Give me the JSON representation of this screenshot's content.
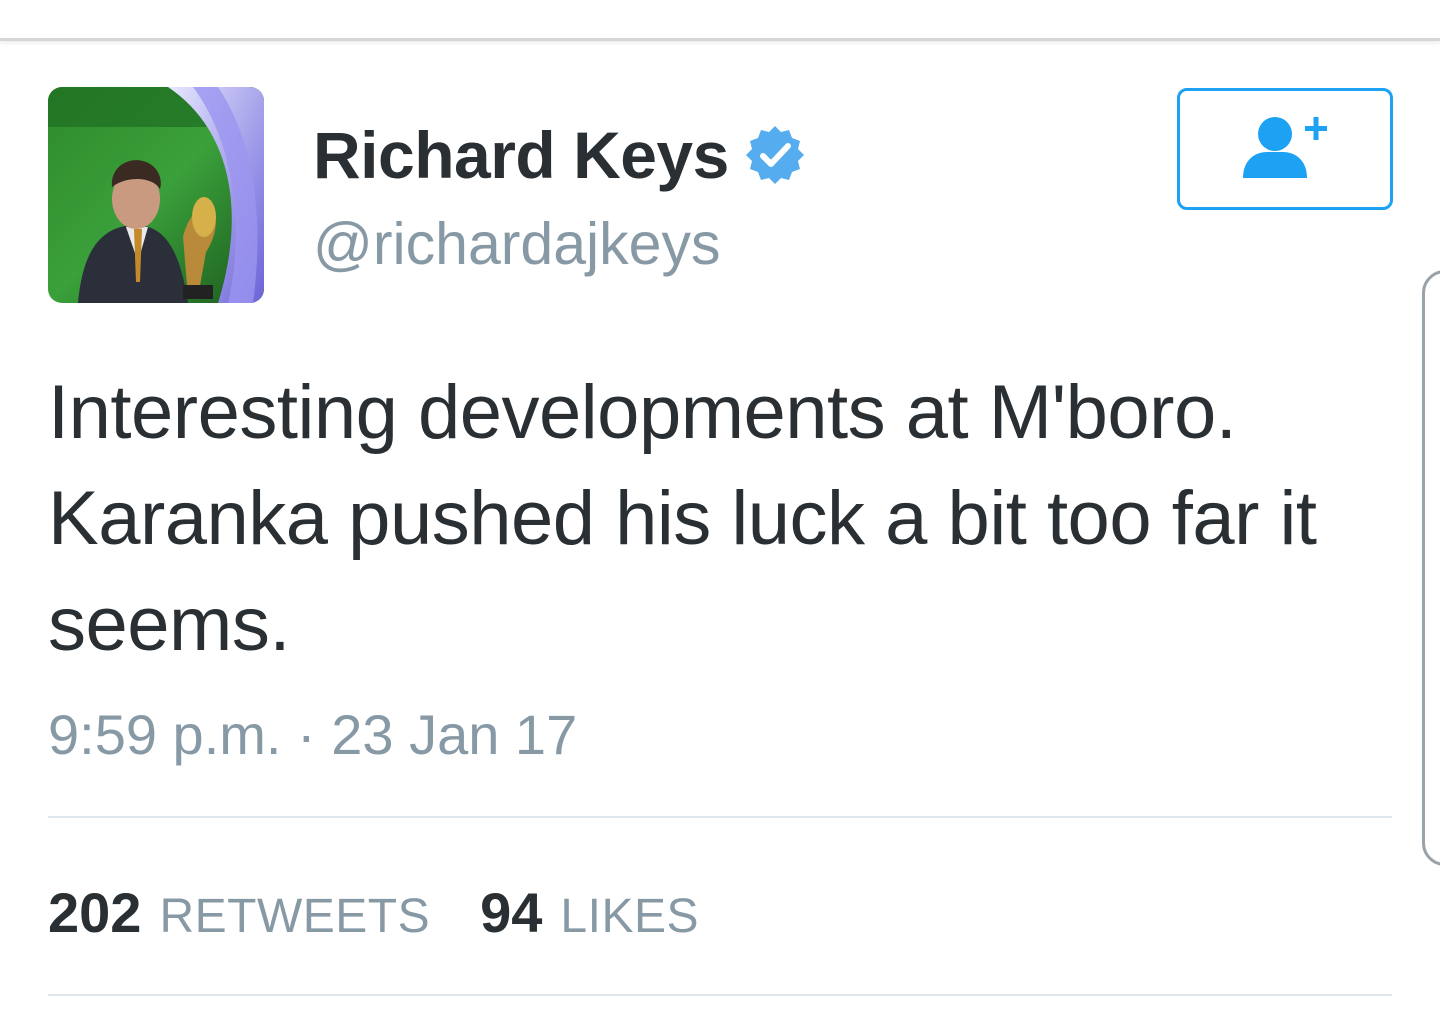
{
  "tweet": {
    "display_name": "Richard Keys",
    "handle": "@richardajkeys",
    "text_lines": [
      "Interesting developments at M'boro.",
      "Karanka pushed his luck a bit too far it",
      "seems."
    ],
    "timestamp": "9:59 p.m. · 23 Jan 17",
    "retweets_count": "202",
    "retweets_label": "RETWEETS",
    "likes_count": "94",
    "likes_label": "LIKES"
  },
  "icons": {
    "verified": "verified-badge-icon",
    "follow": "add-user-icon"
  },
  "colors": {
    "accent": "#1da1f2",
    "verified": "#55acee",
    "text": "#292f33",
    "muted": "#8899a6",
    "divider": "#e1e8ed"
  }
}
